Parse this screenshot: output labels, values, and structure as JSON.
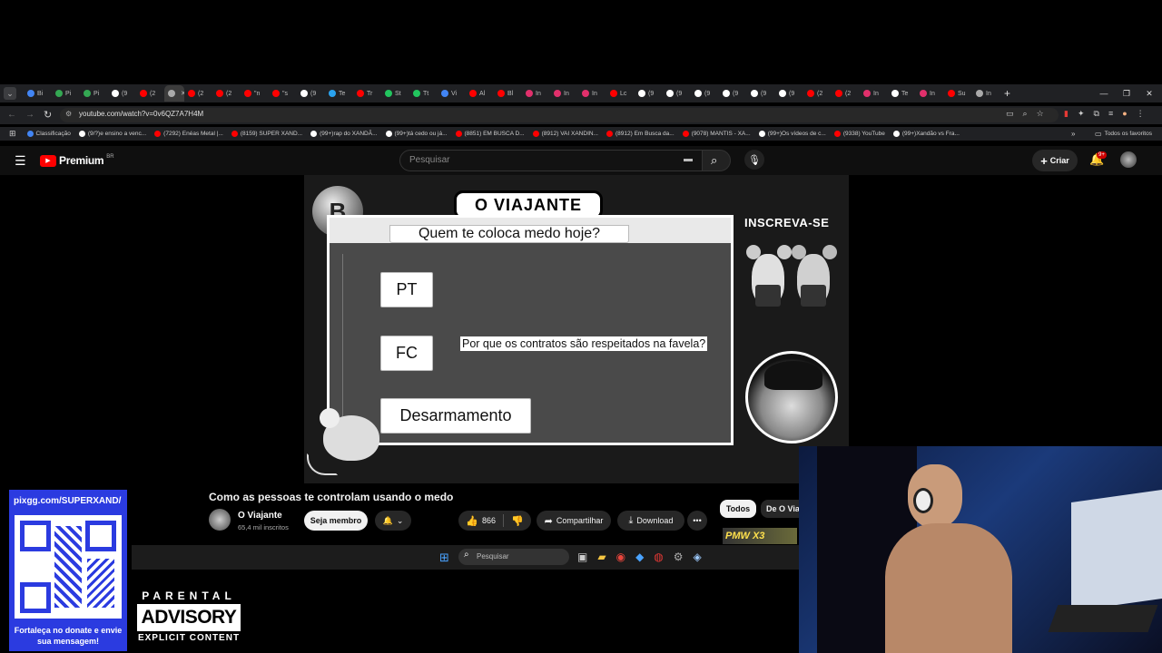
{
  "browser": {
    "tabs": [
      {
        "label": "Bi",
        "color": "#4285f4"
      },
      {
        "label": "Pi",
        "color": "#34a853"
      },
      {
        "label": "Pi",
        "color": "#34a853"
      },
      {
        "label": "(9",
        "color": "#ffffff"
      },
      {
        "label": "(2",
        "color": "#ff0000"
      },
      {
        "label": "",
        "color": "#aaaaaa",
        "active": true
      },
      {
        "label": "(2",
        "color": "#ff0000"
      },
      {
        "label": "(2",
        "color": "#ff0000"
      },
      {
        "label": "\"n",
        "color": "#ff0000"
      },
      {
        "label": "\"s",
        "color": "#ff0000"
      },
      {
        "label": "(9",
        "color": "#ffffff"
      },
      {
        "label": "Te",
        "color": "#2aa3ef"
      },
      {
        "label": "Tr",
        "color": "#ff0000"
      },
      {
        "label": "St",
        "color": "#22c55e"
      },
      {
        "label": "Tt",
        "color": "#22c55e"
      },
      {
        "label": "Vi",
        "color": "#4285f4"
      },
      {
        "label": "Al",
        "color": "#ff0000"
      },
      {
        "label": "Bl",
        "color": "#ff0000"
      },
      {
        "label": "In",
        "color": "#e1306c"
      },
      {
        "label": "In",
        "color": "#e1306c"
      },
      {
        "label": "In",
        "color": "#e1306c"
      },
      {
        "label": "Lc",
        "color": "#ff0000"
      },
      {
        "label": "(9",
        "color": "#ffffff"
      },
      {
        "label": "(9",
        "color": "#ffffff"
      },
      {
        "label": "(9",
        "color": "#ffffff"
      },
      {
        "label": "(9",
        "color": "#ffffff"
      },
      {
        "label": "(9",
        "color": "#ffffff"
      },
      {
        "label": "(9",
        "color": "#ffffff"
      },
      {
        "label": "(2",
        "color": "#ff0000"
      },
      {
        "label": "(2",
        "color": "#ff0000"
      },
      {
        "label": "In",
        "color": "#e1306c"
      },
      {
        "label": "Te",
        "color": "#ffffff"
      },
      {
        "label": "In",
        "color": "#e1306c"
      },
      {
        "label": "Su",
        "color": "#ff0000"
      },
      {
        "label": "In",
        "color": "#aaaaaa"
      }
    ],
    "url": "youtube.com/watch?v=0v6QZ7A7H4M",
    "bookmarks": [
      {
        "label": "Classificação",
        "color": "#4285f4"
      },
      {
        "label": "(9/?)e ensino a venc...",
        "color": "#ffffff"
      },
      {
        "label": "(7292) Enéas Metal |...",
        "color": "#ff0000"
      },
      {
        "label": "(8159) SUPER XAND...",
        "color": "#ff0000"
      },
      {
        "label": "(99+)rap do XANDÃ...",
        "color": "#ffffff"
      },
      {
        "label": "(99+)tá cedo ou já...",
        "color": "#ffffff"
      },
      {
        "label": "(8851) EM BUSCA D...",
        "color": "#ff0000"
      },
      {
        "label": "(8912) VAI XANDIN...",
        "color": "#ff0000"
      },
      {
        "label": "(8912) Em Busca da...",
        "color": "#ff0000"
      },
      {
        "label": "(9078) MANTIS - XA...",
        "color": "#ff0000"
      },
      {
        "label": "(99+)Os vídeos de c...",
        "color": "#ffffff"
      },
      {
        "label": "(9338) YouTube",
        "color": "#ff0000"
      },
      {
        "label": "(99+)Xandão vs Fra...",
        "color": "#ffffff"
      }
    ],
    "all_favorites": "Todos os favoritos"
  },
  "youtube": {
    "logo": "Premium",
    "region": "BR",
    "search_placeholder": "Pesquisar",
    "create_label": "Criar",
    "notifications": "9+",
    "video_title": "Como as pessoas te controlam usando o medo",
    "channel_name": "O Viajante",
    "subscribers": "65,4 mil inscritos",
    "join_label": "Seja membro",
    "likes": "866",
    "share_label": "Compartilhar",
    "download_label": "Download",
    "filters": [
      "Todos",
      "De O Viaj"
    ]
  },
  "video_overlay": {
    "header": "O VIAJANTE",
    "subscribe": "INSCREVA-SE",
    "top_node": "Quem te coloca medo hoje?",
    "nodes": [
      "PT",
      "FC",
      "Desarmamento"
    ],
    "question": "Por que os contratos são respeitados na favela?",
    "bitcoin": "B"
  },
  "taskbar": {
    "search_placeholder": "Pesquisar"
  },
  "stream": {
    "qr_url": "pixgg.com/SUPERXAND/",
    "donate_text": "Fortaleça no donate e envie sua mensagem!",
    "advisory_top": "PARENTAL",
    "advisory_main": "ADVISORY",
    "advisory_bottom": "EXPLICIT CONTENT",
    "badge": "PMW X3"
  }
}
